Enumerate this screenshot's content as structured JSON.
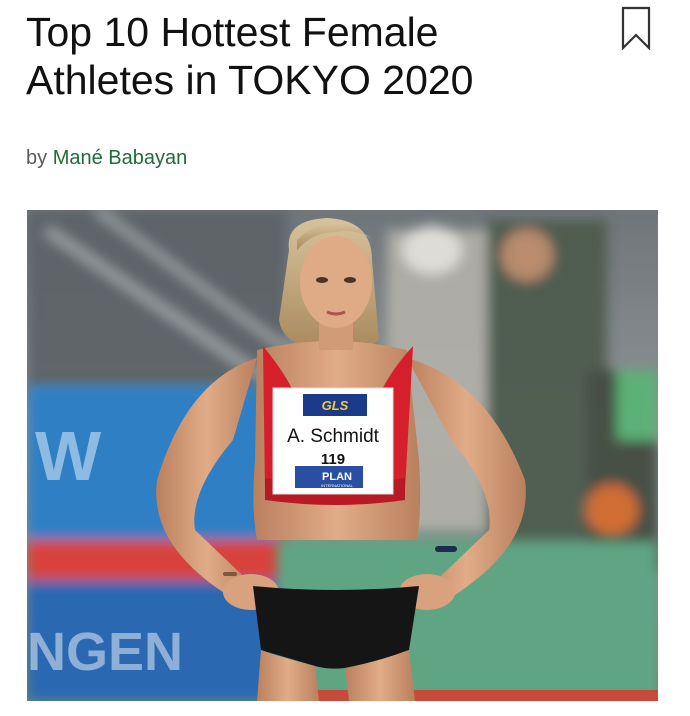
{
  "article": {
    "title": "Top 10 Hottest Female Athletes in TOKYO 2020",
    "byline_prefix": "by",
    "author": "Mané Babayan"
  },
  "icons": {
    "bookmark": "bookmark-icon"
  },
  "hero_image": {
    "bib": {
      "sponsor_top": "GLS",
      "name": "A. Schmidt",
      "number": "119",
      "sponsor_bottom": "PLAN",
      "sponsor_bottom_sub": "INTERNATIONAL"
    },
    "banner_text": "NGEN",
    "colors": {
      "singlet": "#d5202b",
      "shorts": "#151515",
      "track_green": "#5fa583",
      "banner_blue": "#2f7fc4",
      "skin": "#d9a27e"
    }
  }
}
